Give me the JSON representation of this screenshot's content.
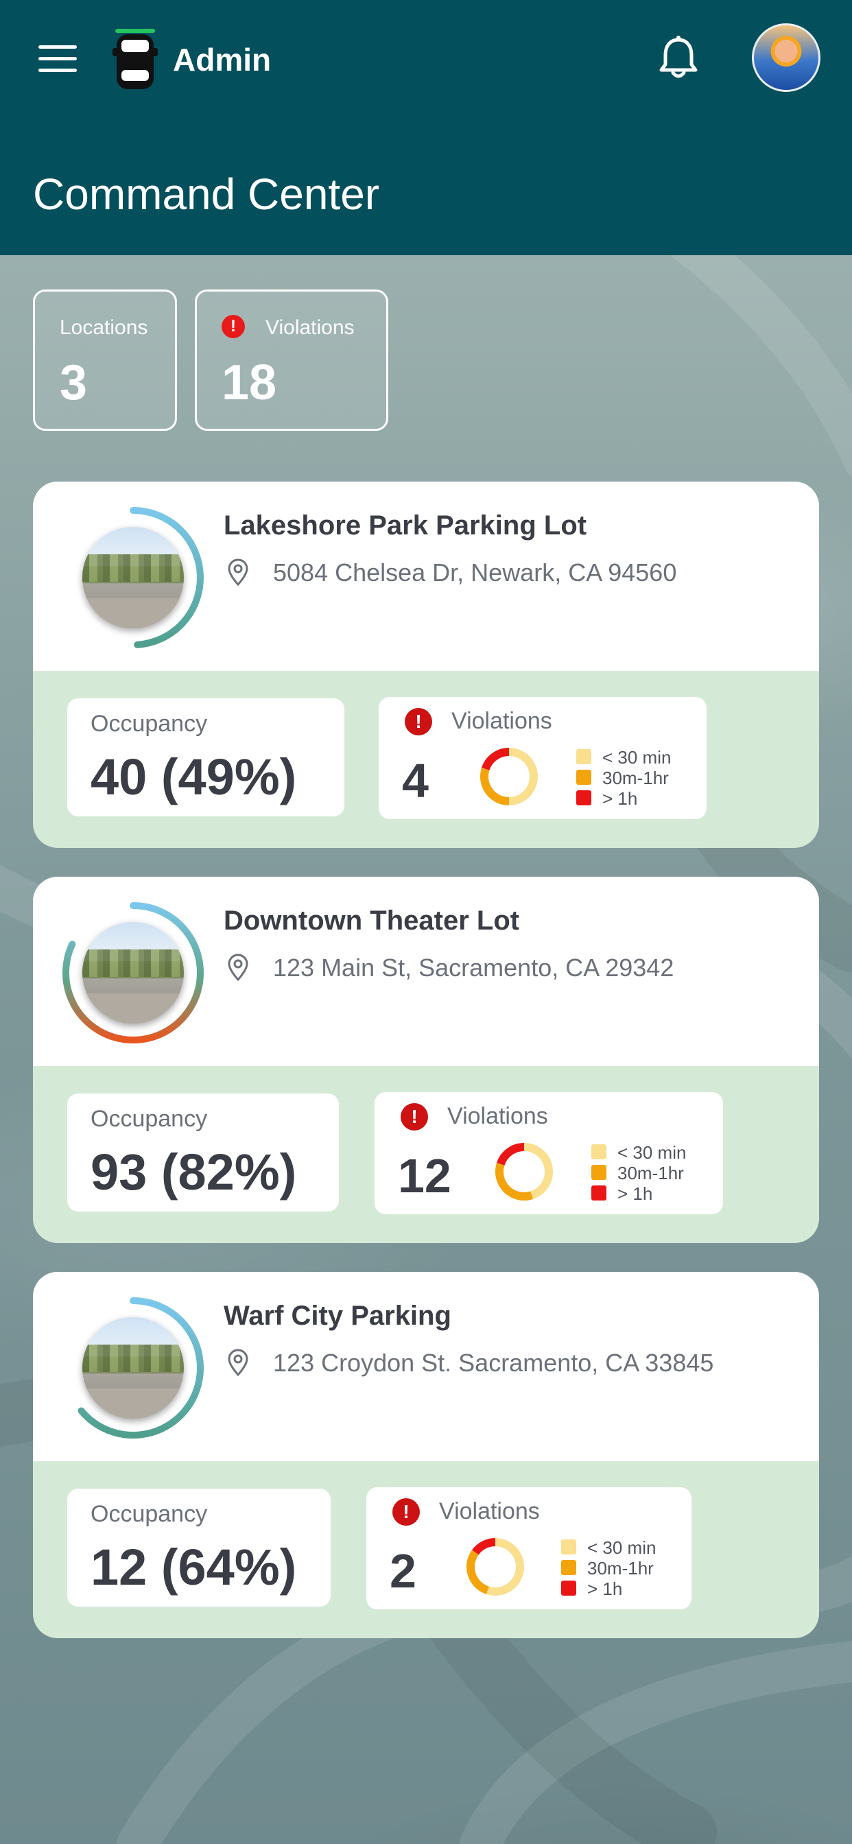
{
  "header": {
    "app_title": "Admin",
    "page_title": "Command Center"
  },
  "summary": {
    "locations_label": "Locations",
    "locations_value": "3",
    "violations_label": "Violations",
    "violations_value": "18",
    "alert_glyph": "!"
  },
  "legend": {
    "lt30": "< 30 min",
    "m30_1h": "30m-1hr",
    "gt1h": "> 1h",
    "colors": {
      "lt30": "#f9df8e",
      "m30_1h": "#f3a40d",
      "gt1h": "#ea1616"
    }
  },
  "locations": [
    {
      "name": "Lakeshore Park Parking Lot",
      "address": "5084 Chelsea Dr, Newark, CA 94560",
      "occupancy_label": "Occupancy",
      "occupancy_value": "40 (49%)",
      "occupancy_fraction": 0.49,
      "violations_label": "Violations",
      "violations_value": "4",
      "violation_split": [
        0.5,
        0.3,
        0.2
      ]
    },
    {
      "name": "Downtown Theater Lot",
      "address": "123 Main St, Sacramento, CA 29342",
      "occupancy_label": "Occupancy",
      "occupancy_value": "93 (82%)",
      "occupancy_fraction": 0.82,
      "violations_label": "Violations",
      "violations_value": "12",
      "violation_split": [
        0.45,
        0.35,
        0.2
      ]
    },
    {
      "name": "Warf City Parking",
      "address": "123 Croydon St. Sacramento, CA 33845",
      "occupancy_label": "Occupancy",
      "occupancy_value": "12 (64%)",
      "occupancy_fraction": 0.64,
      "violations_label": "Violations",
      "violations_value": "2",
      "violation_split": [
        0.55,
        0.3,
        0.15
      ]
    }
  ],
  "icons": {
    "menu": "hamburger-menu-icon",
    "logo": "car-logo-icon",
    "notifications": "bell-icon",
    "location": "map-pin-icon",
    "alert": "alert-icon"
  }
}
